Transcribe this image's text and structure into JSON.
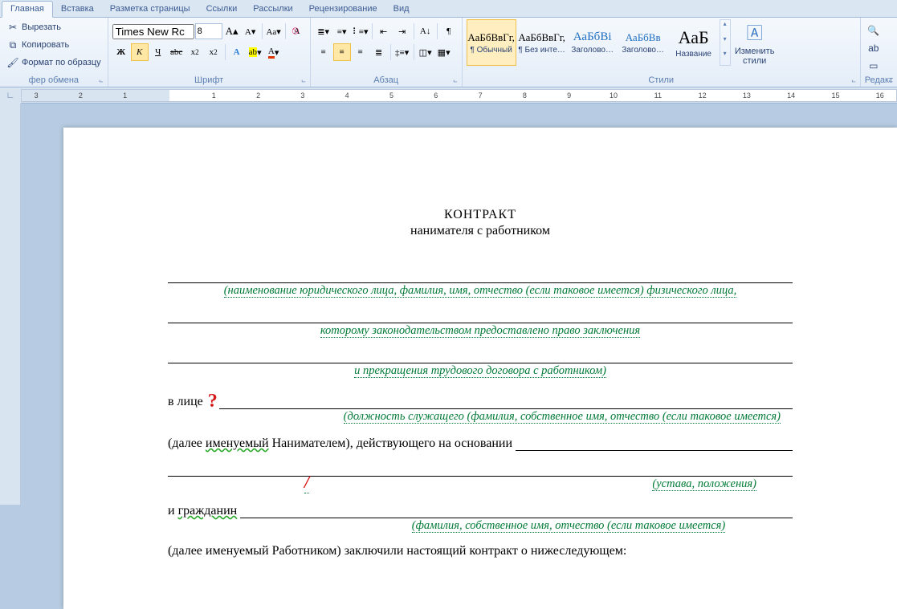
{
  "tabs": [
    "Главная",
    "Вставка",
    "Разметка страницы",
    "Ссылки",
    "Рассылки",
    "Рецензирование",
    "Вид"
  ],
  "active_tab": 0,
  "clipboard": {
    "cut": "Вырезать",
    "copy": "Копировать",
    "painter": "Формат по образцу",
    "group": "фер обмена"
  },
  "font": {
    "name": "Times New Rc",
    "size": "8",
    "group": "Шрифт"
  },
  "paragraph": {
    "group": "Абзац"
  },
  "styles": {
    "items": [
      {
        "preview": "АаБбВвГг,",
        "name": "¶ Обычный",
        "selected": true
      },
      {
        "preview": "АаБбВвГг,",
        "name": "¶ Без инте…",
        "selected": false
      },
      {
        "preview": "АаБбВі",
        "name": "Заголово…",
        "selected": false,
        "color": "#1f6fc2"
      },
      {
        "preview": "АаБбВв",
        "name": "Заголово…",
        "selected": false,
        "color": "#1f6fc2"
      },
      {
        "preview": "АаБ",
        "name": "Название",
        "selected": false,
        "big": true
      }
    ],
    "change_btn": "Изменить стили",
    "group": "Стили"
  },
  "editing": {
    "group": "Редакт"
  },
  "ruler": {
    "start": -2,
    "end": 18,
    "page_left": 0,
    "page_right": 17
  },
  "doc": {
    "title": "КОНТРАКТ",
    "subtitle": "нанимателя с работником",
    "hint1": "(наименование юридического лица, фамилия, имя, отчество (если таковое имеется) физического лица,",
    "hint2": "которому законодательством предоставлено право заключения",
    "hint3": "и прекращения трудового договора с работником)",
    "in_person": "в лице",
    "hint4": "(должность служащего (фамилия, собственное имя, отчество (если таковое имеется)",
    "clause1a": "(далее ",
    "clause1b": "именуемый",
    "clause1c": " Нанимателем), действующего на основании ",
    "hint5": "(устава, положения)",
    "and_citizen_a": "и   ",
    "and_citizen_b": "гражданин ",
    "hint6": "(фамилия, собственное имя, отчество (если таковое имеется)",
    "clause2": "(далее именуемый Работником) заключили настоящий контракт о нижеследующем:"
  }
}
